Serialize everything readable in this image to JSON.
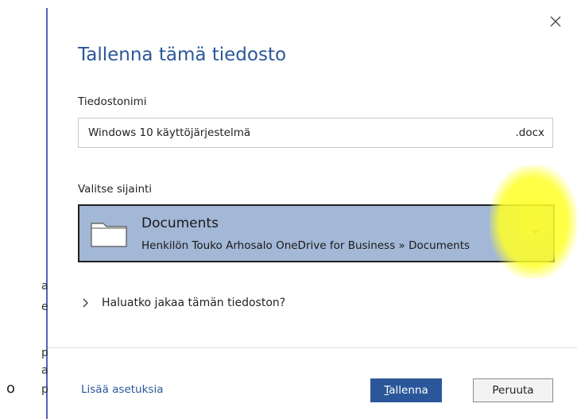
{
  "background": {
    "letters": [
      "a",
      "e",
      "p",
      "a",
      "p"
    ],
    "stray": "o"
  },
  "dialog": {
    "title": "Tallenna tämä tiedosto",
    "filename": {
      "label": "Tiedostonimi",
      "value": "Windows 10 käyttöjärjestelmä",
      "extension": ".docx"
    },
    "location": {
      "label": "Valitse sijainti",
      "name": "Documents",
      "path": "Henkilön Touko Arhosalo OneDrive for Business » Documents"
    },
    "share": {
      "label": "Haluatko jakaa tämän tiedoston?"
    },
    "more_options": "Lisää asetuksia",
    "save_button": {
      "underlined": "T",
      "rest": "allenna"
    },
    "cancel_button": "Peruuta"
  },
  "colors": {
    "accent": "#2b579a",
    "selected_location": "#a3b7d6",
    "highlight": "#ffff28"
  },
  "icons": {
    "close": "close-icon",
    "folder": "folder-icon",
    "dropdown": "chevron-down-icon",
    "expand": "chevron-right-icon"
  }
}
